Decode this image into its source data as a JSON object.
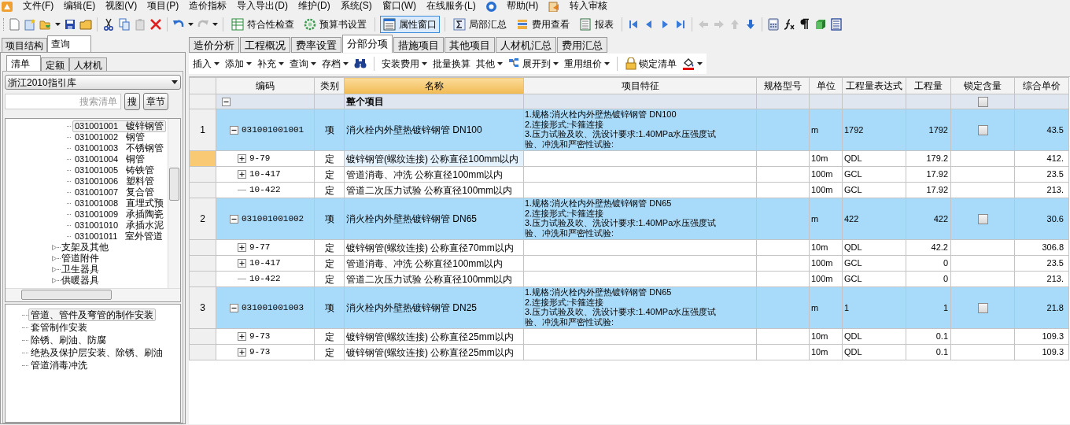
{
  "menu": [
    "文件(F)",
    "编辑(E)",
    "视图(V)",
    "项目(P)",
    "造价指标",
    "导入导出(D)",
    "维护(D)",
    "系统(S)",
    "窗口(W)",
    "在线服务(L)",
    "帮助(H)",
    "转入审核"
  ],
  "toolbar": [
    {
      "label": "符合性检查",
      "pressed": false
    },
    {
      "label": "预算书设置",
      "pressed": false
    },
    {
      "label": "属性窗口",
      "pressed": true
    },
    {
      "label": "局部汇总",
      "pressed": false
    },
    {
      "label": "费用查看",
      "pressed": false
    },
    {
      "label": "报表",
      "pressed": false
    }
  ],
  "doc_tabs": [
    {
      "label": "造价分析",
      "selected": false
    },
    {
      "label": "工程概况",
      "selected": false
    },
    {
      "label": "费率设置",
      "selected": false
    },
    {
      "label": "分部分项",
      "selected": true
    },
    {
      "label": "措施项目",
      "selected": false
    },
    {
      "label": "其他项目",
      "selected": false
    },
    {
      "label": "人材机汇总",
      "selected": false
    },
    {
      "label": "费用汇总",
      "selected": false
    }
  ],
  "edit_toolbar": [
    {
      "label": "插入",
      "dropdown": true
    },
    {
      "label": "添加",
      "dropdown": true
    },
    {
      "label": "补充",
      "dropdown": true
    },
    {
      "label": "查询",
      "dropdown": true
    },
    {
      "label": "存档",
      "dropdown": true
    },
    {
      "label": "安装费用",
      "dropdown": true
    },
    {
      "label": "批量换算",
      "dropdown": false
    },
    {
      "label": "其他",
      "dropdown": true
    },
    {
      "label": "展开到",
      "dropdown": true
    },
    {
      "label": "重用组价",
      "dropdown": true
    },
    {
      "label": "锁定清单",
      "dropdown": false
    }
  ],
  "left_panel": {
    "tabs": [
      {
        "label": "项目结构",
        "selected": false
      },
      {
        "label": "查询",
        "selected": true
      }
    ],
    "subtabs": [
      {
        "label": "清单",
        "selected": true
      },
      {
        "label": "定额",
        "selected": false
      },
      {
        "label": "人材机",
        "selected": false
      }
    ],
    "library": "浙江2010指引库",
    "search": {
      "placeholder": "搜索清单"
    },
    "buttons": [
      "搜",
      "章节"
    ],
    "tree": [
      {
        "children": [
          {
            "code": "031001001",
            "name": "镀锌钢管",
            "selected": true
          },
          {
            "code": "031001002",
            "name": "钢管",
            "selected": false
          },
          {
            "code": "031001003",
            "name": "不锈钢管",
            "selected": false
          },
          {
            "code": "031001004",
            "name": "铜管",
            "selected": false
          },
          {
            "code": "031001005",
            "name": "铸铁管",
            "selected": false
          },
          {
            "code": "031001006",
            "name": "塑料管",
            "selected": false
          },
          {
            "code": "031001007",
            "name": "复合管",
            "selected": false
          },
          {
            "code": "031001008",
            "name": "直埋式预",
            "selected": false
          },
          {
            "code": "031001009",
            "name": "承插陶瓷",
            "selected": false
          },
          {
            "code": "031001010",
            "name": "承插水泥",
            "selected": false
          },
          {
            "code": "031001011",
            "name": "室外管道",
            "selected": false
          }
        ]
      },
      {
        "label": "支架及其他",
        "expanded": false
      },
      {
        "label": "管道附件",
        "expanded": false
      },
      {
        "label": "卫生器具",
        "expanded": false
      },
      {
        "label": "供暖器具",
        "expanded": false
      }
    ],
    "chapters": [
      {
        "label": "管道、管件及弯管的制作安装",
        "selected": true
      },
      {
        "label": "套管制作安装",
        "selected": false
      },
      {
        "label": "除锈、刷油、防腐",
        "selected": false
      },
      {
        "label": "绝热及保护层安装、除锈、刷油",
        "selected": false
      },
      {
        "label": "管道消毒冲洗",
        "selected": false
      }
    ]
  },
  "grid": {
    "columns": [
      {
        "label": "编码",
        "selected": false
      },
      {
        "label": "类别",
        "selected": false
      },
      {
        "label": "名称",
        "selected": true
      },
      {
        "label": "项目特征",
        "selected": false
      },
      {
        "label": "规格型号",
        "selected": false
      },
      {
        "label": "单位",
        "selected": false
      },
      {
        "label": "工程量表达式",
        "selected": false
      },
      {
        "label": "工程量",
        "selected": false
      },
      {
        "label": "锁定含量",
        "selected": false
      },
      {
        "label": "综合单价",
        "selected": false
      }
    ],
    "total_row": {
      "name": "整个项目",
      "expanded": true,
      "locked": false
    },
    "rows": [
      {
        "number": "1",
        "code": "031001001001",
        "type": "项",
        "name": "消火栓内外壁热镀锌钢管 DN100",
        "features": [
          "1.规格:消火栓内外壁热镀锌钢管 DN100",
          "2.连接形式:卡箍连接",
          "3.压力试验及吹、洗设计要求:1.40MPa水压强度试",
          "验、冲洗和严密性试验:"
        ],
        "unit": "m",
        "expression": "1792",
        "quantity": "1792",
        "locked": false,
        "price": "43.5",
        "expanded": true,
        "children": [
          {
            "code": "9-79",
            "type": "定",
            "name": "镀锌钢管(螺纹连接) 公称直径100mm以内",
            "unit": "10m",
            "expression": "QDL",
            "quantity": "179.2",
            "price": "412.",
            "expandable": true,
            "selected": true
          },
          {
            "code": "10-417",
            "type": "定",
            "name": "管道消毒、冲洗 公称直径100mm以内",
            "unit": "100m",
            "expression": "GCL",
            "quantity": "17.92",
            "price": "23.5",
            "expandable": true,
            "selected": false
          },
          {
            "code": "10-422",
            "type": "定",
            "name": "管道二次压力试验 公称直径100mm以内",
            "unit": "100m",
            "expression": "GCL",
            "quantity": "17.92",
            "price": "213.",
            "expandable": false,
            "selected": false
          }
        ]
      },
      {
        "number": "2",
        "code": "031001001002",
        "type": "项",
        "name": "消火栓内外壁热镀锌钢管 DN65",
        "features": [
          "1.规格:消火栓内外壁热镀锌钢管 DN65",
          "2.连接形式:卡箍连接",
          "3.压力试验及吹、洗设计要求:1.40MPa水压强度试",
          "验、冲洗和严密性试验:"
        ],
        "unit": "m",
        "expression": "422",
        "quantity": "422",
        "locked": false,
        "price": "30.6",
        "expanded": true,
        "children": [
          {
            "code": "9-77",
            "type": "定",
            "name": "镀锌钢管(螺纹连接) 公称直径70mm以内",
            "unit": "10m",
            "expression": "QDL",
            "quantity": "42.2",
            "price": "306.8",
            "expandable": true,
            "selected": false
          },
          {
            "code": "10-417",
            "type": "定",
            "name": "管道消毒、冲洗 公称直径100mm以内",
            "unit": "100m",
            "expression": "GCL",
            "quantity": "0",
            "price": "23.5",
            "expandable": true,
            "selected": false
          },
          {
            "code": "10-422",
            "type": "定",
            "name": "管道二次压力试验 公称直径100mm以内",
            "unit": "100m",
            "expression": "GCL",
            "quantity": "0",
            "price": "213.",
            "expandable": false,
            "selected": false
          }
        ]
      },
      {
        "number": "3",
        "code": "031001001003",
        "type": "项",
        "name": "消火栓内外壁热镀锌钢管 DN25",
        "features": [
          "1.规格:消火栓内外壁热镀锌钢管 DN65",
          "2.连接形式:卡箍连接",
          "3.压力试验及吹、洗设计要求:1.40MPa水压强度试",
          "验、冲洗和严密性试验:"
        ],
        "unit": "m",
        "expression": "1",
        "quantity": "1",
        "locked": false,
        "price": "21.8",
        "expanded": true,
        "children": [
          {
            "code": "9-73",
            "type": "定",
            "name": "镀锌钢管(螺纹连接) 公称直径25mm以内",
            "unit": "10m",
            "expression": "QDL",
            "quantity": "0.1",
            "price": "109.3",
            "expandable": true,
            "selected": false
          },
          {
            "code": "9-73",
            "type": "定",
            "name": "镀锌钢管(螺纹连接) 公称直径25mm以内",
            "unit": "10m",
            "expression": "QDL",
            "quantity": "0.1",
            "price": "109.3",
            "expandable": true,
            "selected": false
          }
        ]
      }
    ]
  }
}
